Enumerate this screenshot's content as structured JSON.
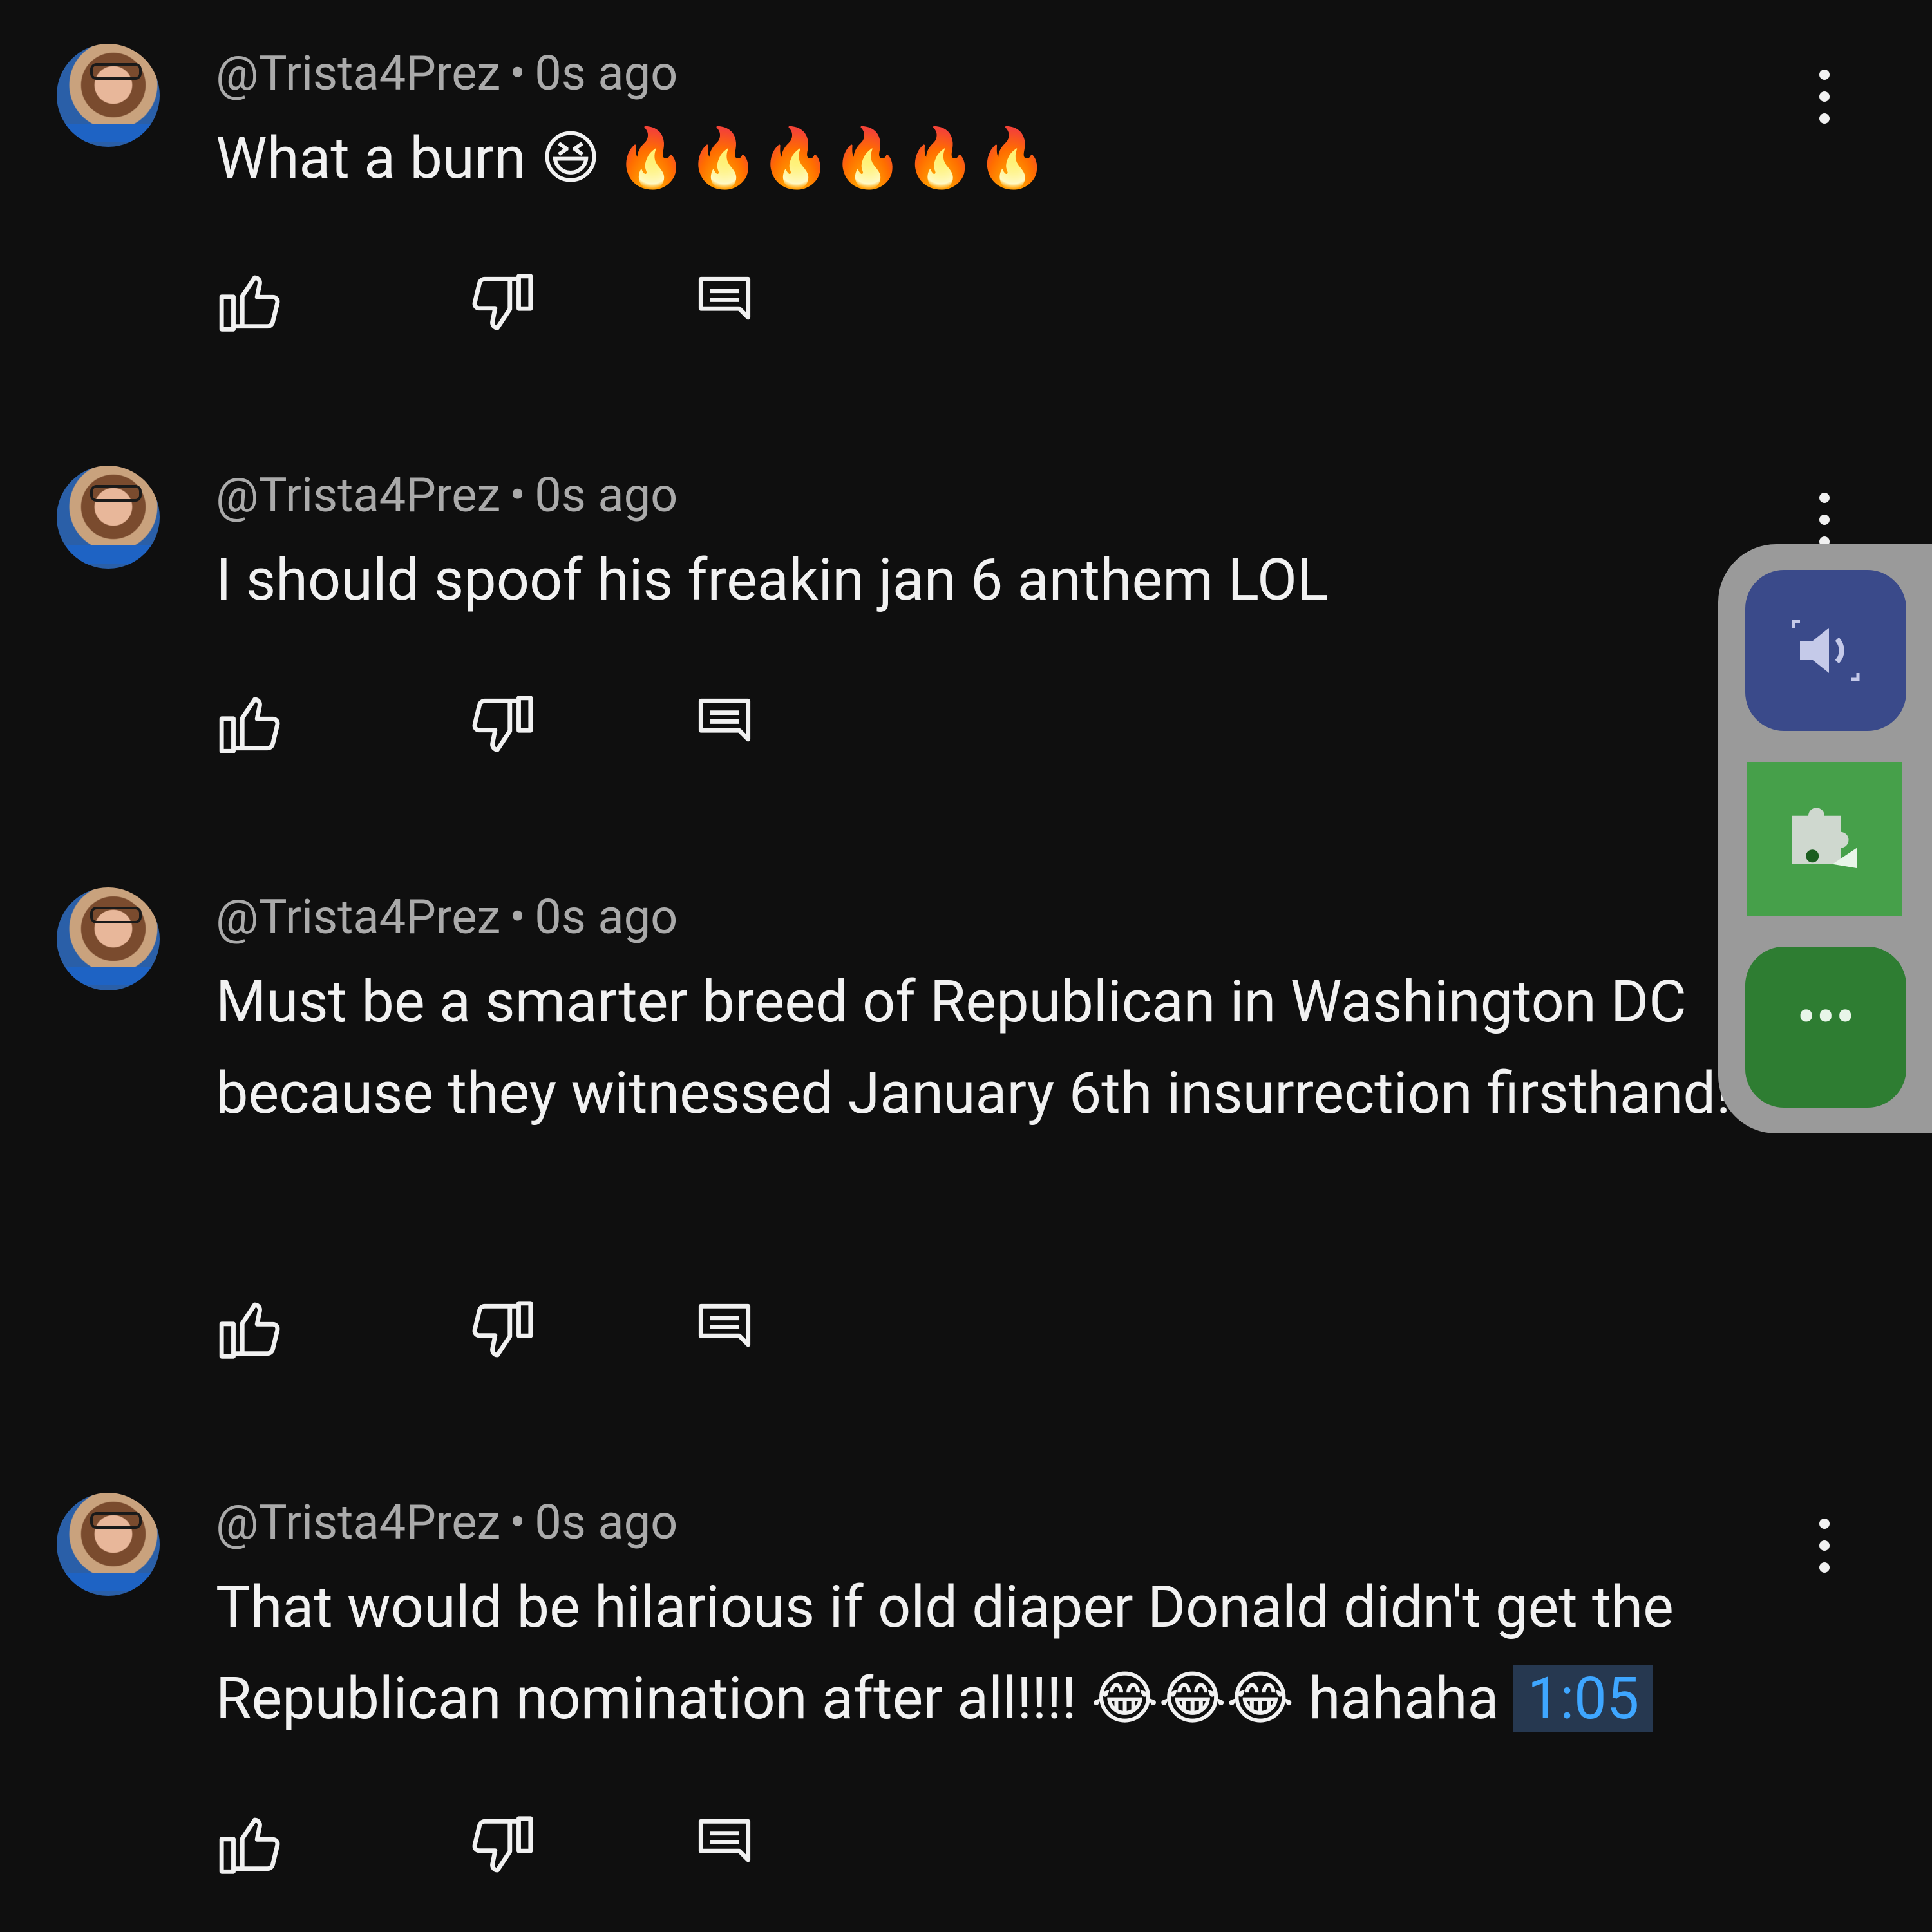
{
  "comments": [
    {
      "author": "@Trista4Prez",
      "age": "0s ago",
      "text": "What a burn 😆 🔥🔥🔥🔥🔥🔥"
    },
    {
      "author": "@Trista4Prez",
      "age": "0s ago",
      "text": "I should spoof his freakin jan 6 anthem LOL"
    },
    {
      "author": "@Trista4Prez",
      "age": "0s ago",
      "text": "Must be a smarter breed of Republican in Washington DC because they witnessed January 6th insurrection firsthand!"
    },
    {
      "author": "@Trista4Prez",
      "age": "0s ago",
      "text": "That would be hilarious if old diaper Donald didn't get the Republican nomination after all!!!! 😂😂😂 hahaha",
      "timestamp": "1:05"
    }
  ],
  "separator": "•",
  "side_panel": {
    "more_label": "•••",
    "voice_icon": "speaker-icon",
    "extension_icon": "puzzle-icon"
  },
  "colors": {
    "background": "#0f0f0f",
    "text": "#f1f1f1",
    "meta": "#aaaaaa",
    "link": "#3ea6ff"
  }
}
